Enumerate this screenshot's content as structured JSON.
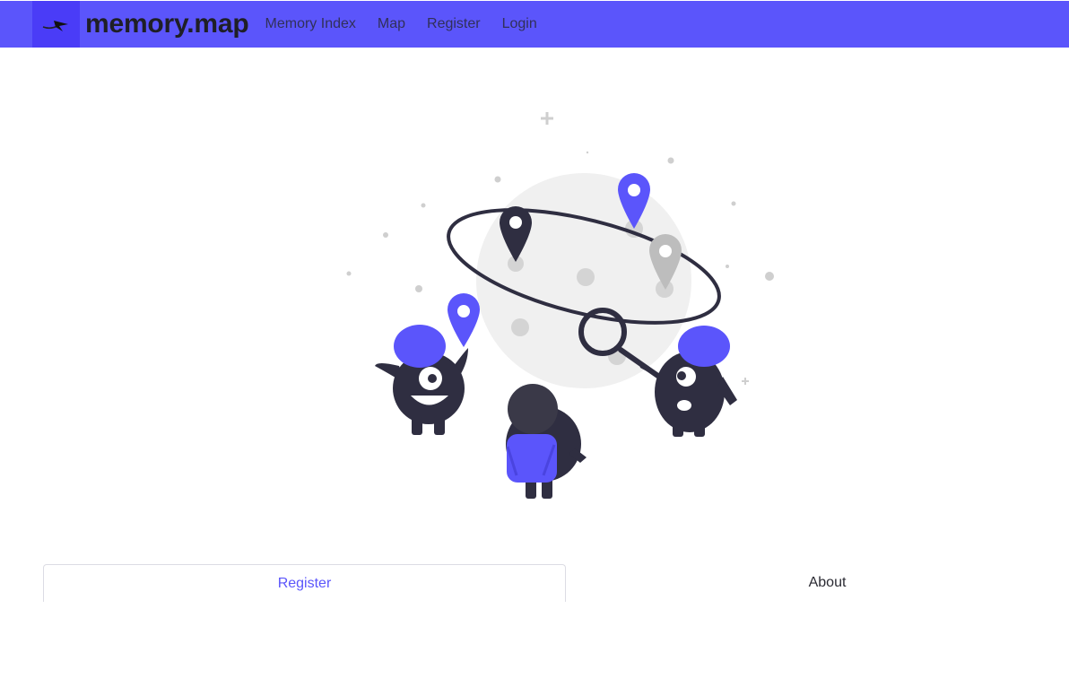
{
  "navbar": {
    "brand_name": "memory.map",
    "links": [
      "Memory Index",
      "Map",
      "Register",
      "Login"
    ]
  },
  "hero": {
    "illustration_icon": "planet-map-pins-monsters-illustration"
  },
  "tabs": [
    "Register",
    "About"
  ],
  "colors": {
    "accent": "#5b55fb",
    "brand_logo_bg": "#4a3cf7",
    "dark_figure": "#2f2e41",
    "planet": "#f0f0f0",
    "grey_pin": "#bdbdbd"
  }
}
